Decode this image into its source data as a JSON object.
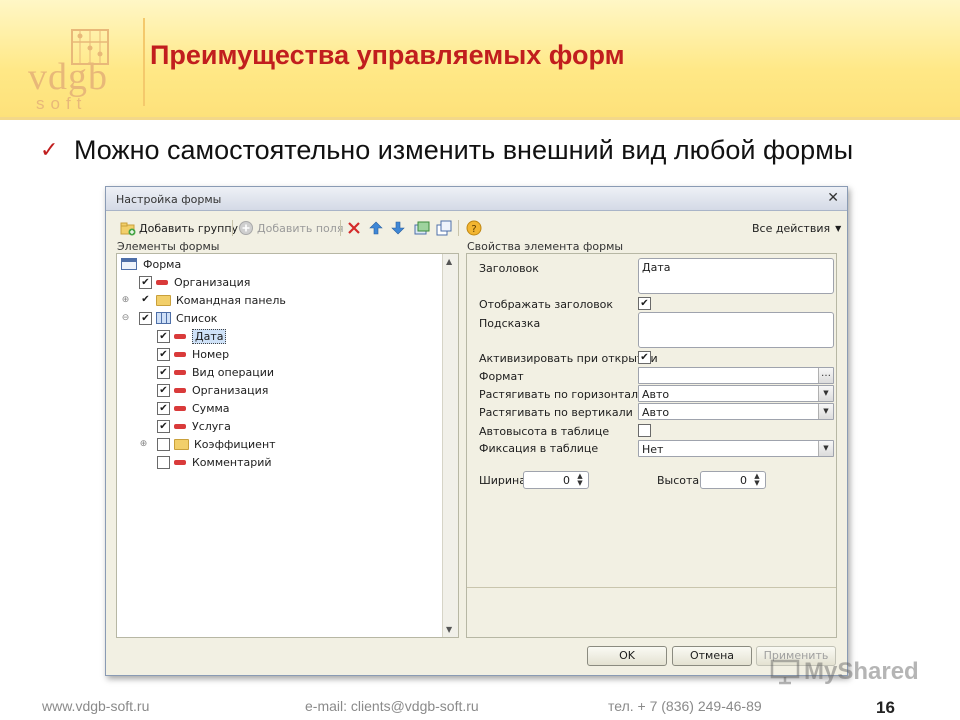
{
  "slide": {
    "logo": {
      "main": "vdgb",
      "sub": "soft"
    },
    "title": "Преимущества управляемых форм",
    "bullet": "Можно самостоятельно изменить внешний вид любой формы",
    "page_number": "16"
  },
  "footer": {
    "site": "www.vdgb-soft.ru",
    "email": "e-mail: clients@vdgb-soft.ru",
    "phone": "тел. + 7 (836) 249-46-89"
  },
  "watermark": "MyShared",
  "dialog": {
    "title": "Настройка формы",
    "toolbar": {
      "add_group": "Добавить группу",
      "add_fields": "Добавить поля",
      "all_actions": "Все действия"
    },
    "left_section_label": "Элементы формы",
    "right_section_label": "Свойства элемента формы",
    "tree": [
      {
        "label": "Форма",
        "level": 0,
        "icon": "form-icon",
        "checkbox": null,
        "expander": ""
      },
      {
        "label": "Организация",
        "level": 1,
        "icon": "field-icon",
        "checkbox": true,
        "expander": ""
      },
      {
        "label": "Командная панель",
        "level": 1,
        "icon": "folder-icon",
        "checkbox": true,
        "expander": "plus",
        "checkbox_style": "tick-only"
      },
      {
        "label": "Список",
        "level": 1,
        "icon": "table-icon",
        "checkbox": true,
        "expander": "minus"
      },
      {
        "label": "Дата",
        "level": 2,
        "icon": "field-icon",
        "checkbox": true,
        "expander": "",
        "selected": true
      },
      {
        "label": "Номер",
        "level": 2,
        "icon": "field-icon",
        "checkbox": true,
        "expander": ""
      },
      {
        "label": "Вид операции",
        "level": 2,
        "icon": "field-icon",
        "checkbox": true,
        "expander": ""
      },
      {
        "label": "Организация",
        "level": 2,
        "icon": "field-icon",
        "checkbox": true,
        "expander": ""
      },
      {
        "label": "Сумма",
        "level": 2,
        "icon": "field-icon",
        "checkbox": true,
        "expander": ""
      },
      {
        "label": "Услуга",
        "level": 2,
        "icon": "field-icon",
        "checkbox": true,
        "expander": ""
      },
      {
        "label": "Коэффициент",
        "level": 2,
        "icon": "folder-icon",
        "checkbox": false,
        "expander": "plus"
      },
      {
        "label": "Комментарий",
        "level": 2,
        "icon": "field-icon",
        "checkbox": false,
        "expander": ""
      }
    ],
    "props": {
      "header_label": "Заголовок",
      "header_value": "Дата",
      "show_header_label": "Отображать заголовок",
      "show_header_checked": true,
      "hint_label": "Подсказка",
      "hint_value": "",
      "activate_label": "Активизировать при открытии",
      "activate_checked": true,
      "format_label": "Формат",
      "format_value": "",
      "stretch_h_label": "Растягивать по горизонтали",
      "stretch_h_value": "Авто",
      "stretch_v_label": "Растягивать по вертикали",
      "stretch_v_value": "Авто",
      "autoheight_label": "Автовысота в таблице",
      "autoheight_checked": false,
      "fix_label": "Фиксация в таблице",
      "fix_value": "Нет",
      "width_label": "Ширина",
      "width_value": "0",
      "height_label": "Высота",
      "height_value": "0"
    },
    "buttons": {
      "ok": "OK",
      "cancel": "Отмена",
      "apply": "Применить"
    }
  }
}
